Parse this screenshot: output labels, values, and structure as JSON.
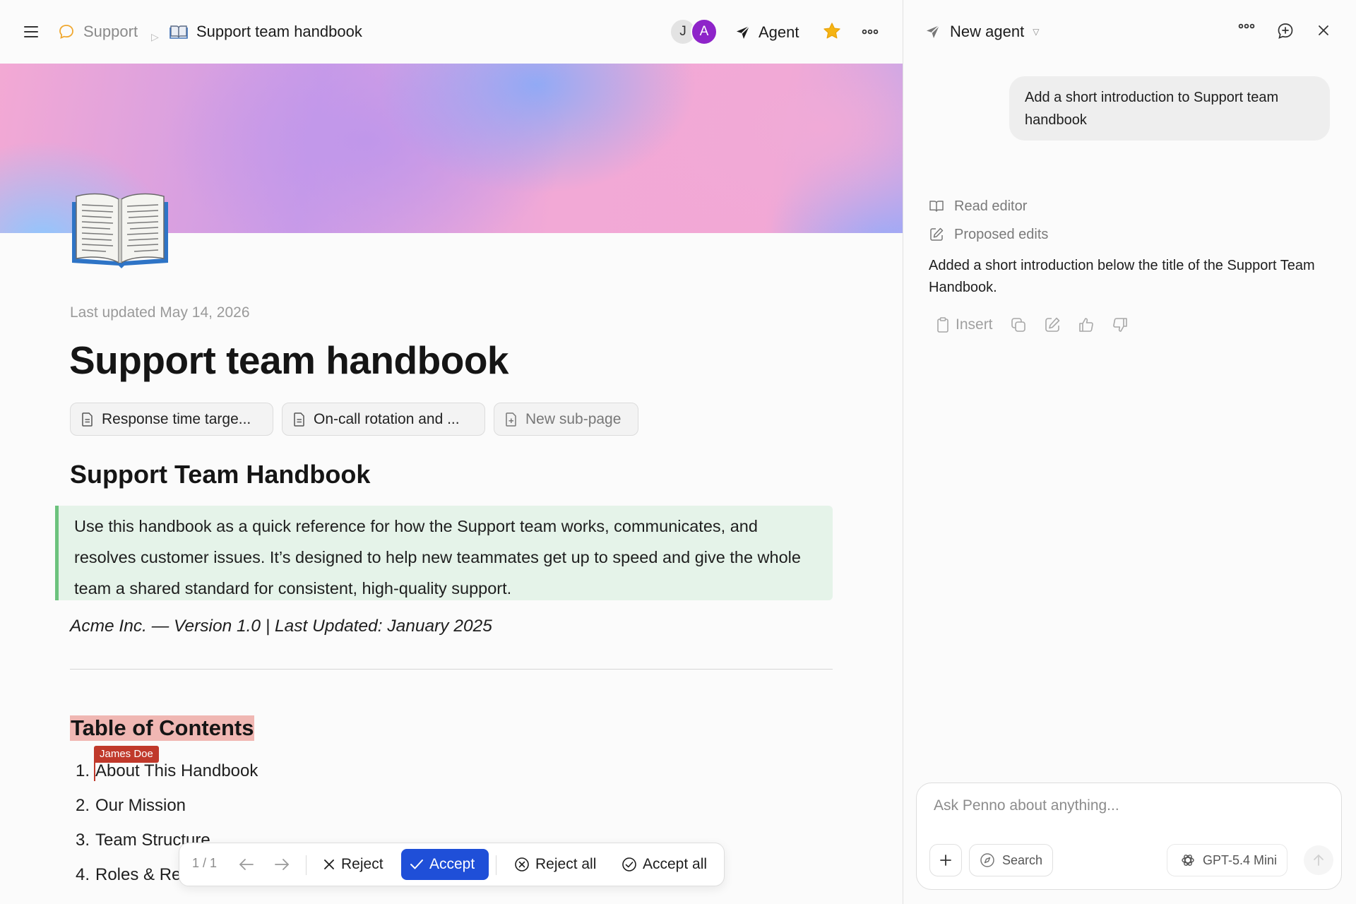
{
  "breadcrumb": {
    "parent": "Support",
    "current": "Support team handbook"
  },
  "header": {
    "avatars": [
      "J",
      "A"
    ],
    "agent_label": "Agent"
  },
  "page": {
    "last_updated": "Last updated May 14, 2026",
    "title": "Support team handbook",
    "subpages": [
      {
        "label": "Response time targe..."
      },
      {
        "label": "On-call rotation and ..."
      },
      {
        "label": "New sub-page"
      }
    ],
    "section_heading": "Support Team Handbook",
    "intro_text": "Use this handbook as a quick reference for how the Support team works, communicates, and resolves customer issues. It’s designed to help new teammates get up to speed and give the whole team a shared standard for consistent, high-quality support.",
    "meta_line": "Acme Inc. — Version 1.0 | Last Updated: January 2025",
    "toc_title": "Table of Contents",
    "collaborator_cursor": "James Doe",
    "toc_items": [
      {
        "num": "1.",
        "label": "About This Handbook"
      },
      {
        "num": "2.",
        "label": "Our Mission"
      },
      {
        "num": "3.",
        "label": "Team Structure"
      },
      {
        "num": "4.",
        "label": "Roles & Re"
      }
    ]
  },
  "review_bar": {
    "count": "1 / 1",
    "reject": "Reject",
    "accept": "Accept",
    "reject_all": "Reject all",
    "accept_all": "Accept all",
    "accept_color": "#1f4fd8"
  },
  "agent_panel": {
    "title": "New agent",
    "user_message": "Add a short introduction to Support team handbook",
    "steps": [
      {
        "label": "Read editor",
        "icon": "book-open-icon"
      },
      {
        "label": "Proposed edits",
        "icon": "edit-icon"
      }
    ],
    "response": "Added a short introduction below the title of the Support Team Handbook.",
    "insert_label": "Insert",
    "composer": {
      "placeholder": "Ask Penno about anything...",
      "search_label": "Search",
      "model_label": "GPT-5.4 Mini"
    }
  },
  "colors": {
    "intro_highlight": "#e5f3e9",
    "intro_border": "#6cc27d",
    "toc_highlight": "#f0b7b3",
    "cursor_color": "#c0392b",
    "avatar_a": "#8e24c9",
    "favorite_star": "#f5b414"
  }
}
